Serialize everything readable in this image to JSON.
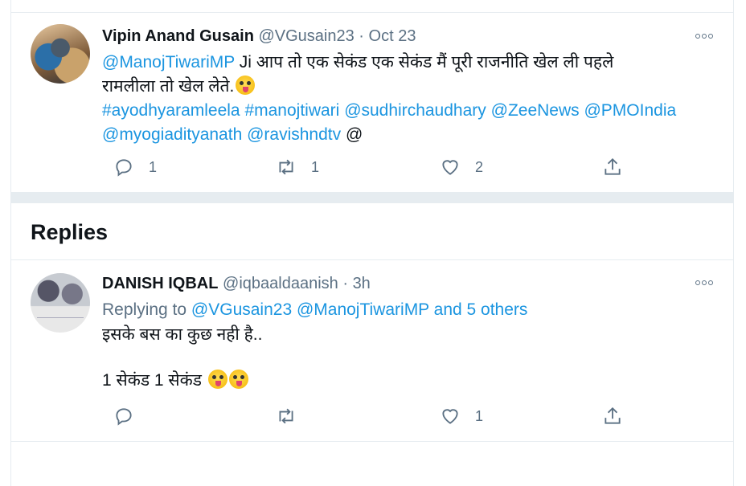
{
  "main_tweet": {
    "author_name": "Vipin Anand Gusain",
    "handle": "@VGusain23",
    "separator": "·",
    "time": "Oct 23",
    "mention": "@ManojTiwariMP",
    "text_line1": " Ji आप तो एक सेकंड एक सेकंड मैं पूरी राजनीति खेल ली पहले",
    "text_line2": "रामलीला तो खेल लेते.",
    "tags_line1": [
      "#ayodhyaramleela",
      "#manojtiwari",
      "@sudhirchaudhary",
      "@ZeeNews",
      "@PMOIndia"
    ],
    "tags_line2": [
      "@myogiadityanath",
      "@ravishndtv"
    ],
    "tags_trailing": "@",
    "reply_count": "1",
    "retweet_count": "1",
    "like_count": "2"
  },
  "replies_heading": "Replies",
  "reply_tweet": {
    "author_name": "DANISH IQBAL",
    "handle": "@iqbaaldaanish",
    "separator": "·",
    "time": "3h",
    "replying_prefix": "Replying to ",
    "replying_to": "@VGusain23 @ManojTiwariMP and 5 others",
    "text_line1": "इसके बस का कुछ नही है..",
    "text_line2": "1 सेकंड 1 सेकंड ",
    "reply_count": "",
    "retweet_count": "",
    "like_count": "1"
  },
  "icons": {
    "reply": "reply-icon",
    "retweet": "retweet-icon",
    "like": "heart-icon",
    "share": "share-icon",
    "more": "more-options-icon"
  },
  "colors": {
    "link": "#1b95e0",
    "muted": "#5b7083",
    "divider": "#e6ecf0"
  }
}
